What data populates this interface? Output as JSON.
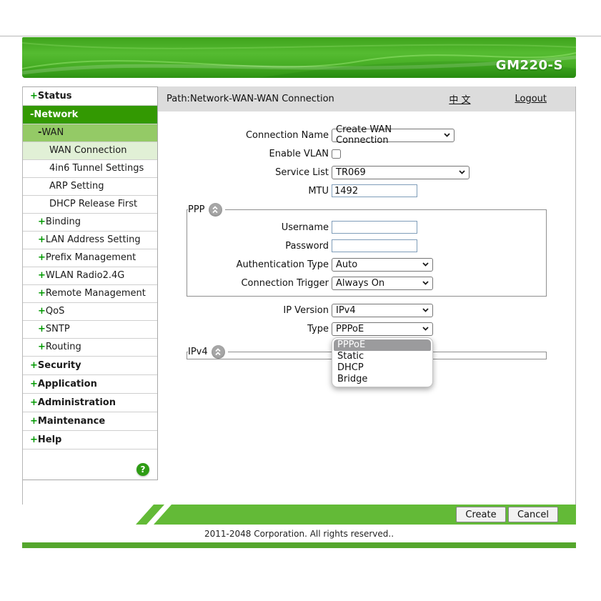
{
  "header": {
    "model_name": "GM220-S"
  },
  "path_bar": {
    "path_text": "Path:Network-WAN-WAN Connection",
    "language_link": "中 文",
    "logout_link": "Logout"
  },
  "sidebar": {
    "items": [
      {
        "prefix": "+",
        "label": "Status"
      },
      {
        "prefix": "-",
        "label": "Network"
      },
      {
        "prefix": "-",
        "label": "WAN"
      },
      {
        "prefix": "",
        "label": "WAN Connection"
      },
      {
        "prefix": "",
        "label": "4in6 Tunnel Settings"
      },
      {
        "prefix": "",
        "label": "ARP Setting"
      },
      {
        "prefix": "",
        "label": "DHCP Release First"
      },
      {
        "prefix": "+",
        "label": "Binding"
      },
      {
        "prefix": "+",
        "label": "LAN Address Setting"
      },
      {
        "prefix": "+",
        "label": "Prefix Management"
      },
      {
        "prefix": "+",
        "label": "WLAN Radio2.4G"
      },
      {
        "prefix": "+",
        "label": "Remote Management"
      },
      {
        "prefix": "+",
        "label": "QoS"
      },
      {
        "prefix": "+",
        "label": "SNTP"
      },
      {
        "prefix": "+",
        "label": "Routing"
      },
      {
        "prefix": "+",
        "label": "Security"
      },
      {
        "prefix": "+",
        "label": "Application"
      },
      {
        "prefix": "+",
        "label": "Administration"
      },
      {
        "prefix": "+",
        "label": "Maintenance"
      },
      {
        "prefix": "+",
        "label": "Help"
      }
    ],
    "help_icon_label": "?"
  },
  "form": {
    "connection_name": {
      "label": "Connection Name",
      "value": "Create WAN Connection"
    },
    "enable_vlan": {
      "label": "Enable VLAN",
      "checked": false
    },
    "service_list": {
      "label": "Service List",
      "value": "TR069"
    },
    "mtu": {
      "label": "MTU",
      "value": "1492"
    },
    "ppp_section": {
      "legend": "PPP",
      "username": {
        "label": "Username",
        "value": ""
      },
      "password": {
        "label": "Password",
        "value": ""
      },
      "authentication_type": {
        "label": "Authentication Type",
        "value": "Auto"
      },
      "connection_trigger": {
        "label": "Connection Trigger",
        "value": "Always On"
      }
    },
    "ip_version": {
      "label": "IP Version",
      "value": "IPv4"
    },
    "type": {
      "label": "Type",
      "value": "PPPoE"
    },
    "type_dropdown": {
      "options": [
        "PPPoE",
        "Static",
        "DHCP",
        "Bridge"
      ],
      "selected": "PPPoE"
    },
    "ipv4_section": {
      "legend": "IPv4"
    }
  },
  "actions": {
    "create_label": "Create",
    "cancel_label": "Cancel"
  },
  "footer": {
    "copyright": "2011-2048 Corporation. All rights reserved.."
  },
  "colors": {
    "banner_green": "#46ad24",
    "nav_active_dark": "#339902",
    "nav_active_mid": "#94ca66",
    "nav_active_light": "#e1f0d6",
    "plus_green": "#009900",
    "action_bar_green": "#63ba37",
    "bottom_bar_green": "#54a62c",
    "dropdown_highlight": "#9b9b9d"
  }
}
